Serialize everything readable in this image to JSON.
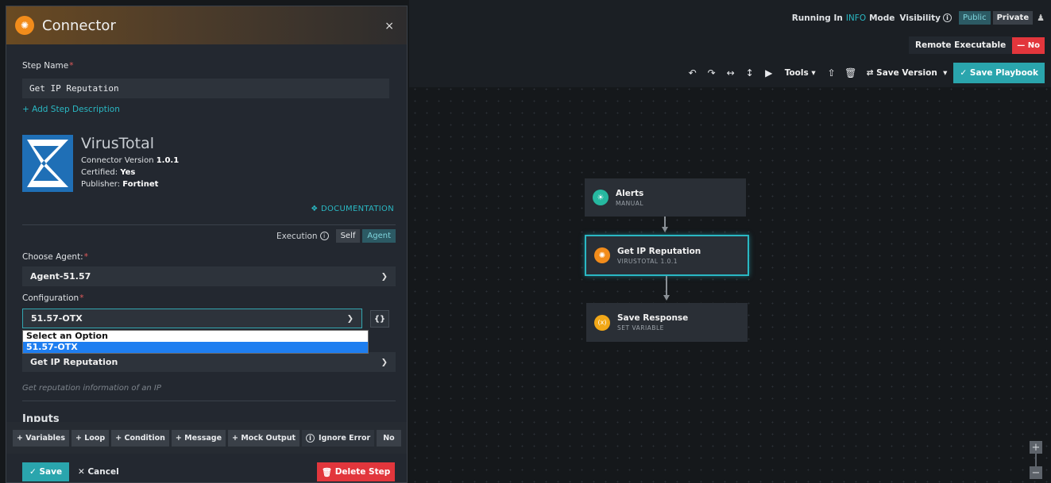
{
  "panel": {
    "title": "Connector",
    "close_icon": "×",
    "step_name_label": "Step Name",
    "step_name_value": "Get IP Reputation",
    "add_description": "+ Add Step Description",
    "connector": {
      "name": "VirusTotal",
      "version_label": "Connector Version",
      "version": "1.0.1",
      "certified_label": "Certified:",
      "certified": "Yes",
      "publisher_label": "Publisher:",
      "publisher": "Fortinet",
      "documentation": "DOCUMENTATION"
    },
    "execution": {
      "label": "Execution",
      "options": [
        "Self",
        "Agent"
      ]
    },
    "choose_agent_label": "Choose Agent:",
    "agent_value": "Agent-51.57",
    "configuration_label": "Configuration",
    "configuration_value": "51.57-OTX",
    "braces": "{}",
    "dropdown_options": [
      "Select an Option",
      "51.57-OTX"
    ],
    "action_value": "Get IP Reputation",
    "action_description": "Get reputation information of an IP",
    "inputs_title": "Inputs",
    "bottom_toolbar": {
      "variables": "+ Variables",
      "loop": "+ Loop",
      "condition": "+ Condition",
      "message": "+ Message",
      "mock_output": "+ Mock Output",
      "ignore_error": "Ignore Error",
      "no": "No"
    },
    "save": "Save",
    "cancel": "Cancel",
    "delete_step": "Delete Step"
  },
  "topbar": {
    "running_in": "Running In",
    "mode": "INFO",
    "mode_suffix": "Mode",
    "visibility": "Visibility",
    "public": "Public",
    "private": "Private",
    "remote_executable": "Remote Executable",
    "remote_no": "— No",
    "tools": "Tools",
    "save_version": "Save Version",
    "save_playbook": "Save Playbook"
  },
  "nodes": [
    {
      "title": "Alerts",
      "subtitle": "MANUAL",
      "color": "#26b8a0",
      "icon": "bulb-icon"
    },
    {
      "title": "Get IP Reputation",
      "subtitle": "VIRUSTOTAL 1.0.1",
      "color": "#f28c1b",
      "icon": "plug-icon"
    },
    {
      "title": "Save Response",
      "subtitle": "SET VARIABLE",
      "color": "#f2a818",
      "icon": "variable-icon"
    }
  ],
  "colors": {
    "accent": "#2ab8c3",
    "danger": "#e2363c",
    "brand_orange": "#f28c1b"
  }
}
